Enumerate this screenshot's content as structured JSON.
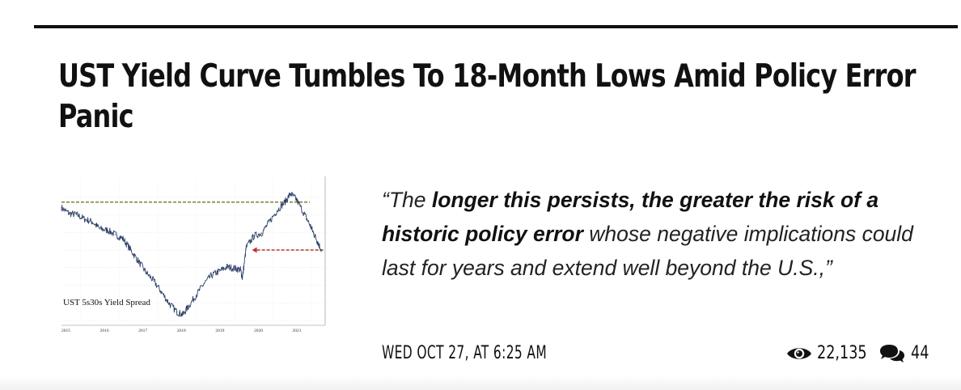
{
  "article": {
    "headline": "UST Yield Curve Tumbles To 18-Month Lows Amid Policy Error Panic",
    "excerpt": {
      "open_quote": "“The ",
      "bold_part": "longer this persists, the greater the risk of a historic policy error",
      "rest": " whose negative implications could last for years and extend well beyond the U.S.,”"
    },
    "date": "WED OCT 27, AT 6:25 AM",
    "views": "22,135",
    "comments": "44",
    "icons": {
      "views": "eye-icon",
      "comments": "comments-icon"
    }
  },
  "chart_data": {
    "type": "line",
    "title": "UST 5s30s Yield Spread",
    "x_tick_labels": [
      "2015",
      "2016",
      "2017",
      "2018",
      "2019",
      "2020",
      "2021"
    ],
    "xlim": [
      2015.0,
      2021.85
    ],
    "ylim": [
      0,
      100
    ],
    "series": [
      {
        "color": "#2b3e66",
        "x": [
          2015.0,
          2015.2,
          2015.4,
          2015.6,
          2015.8,
          2016.0,
          2016.2,
          2016.4,
          2016.6,
          2016.8,
          2017.0,
          2017.2,
          2017.4,
          2017.6,
          2017.8,
          2018.0,
          2018.15,
          2018.3,
          2018.5,
          2018.7,
          2018.9,
          2019.1,
          2019.3,
          2019.5,
          2019.65,
          2019.7,
          2019.8,
          2020.0,
          2020.2,
          2020.4,
          2020.6,
          2020.8,
          2020.95,
          2021.1,
          2021.3,
          2021.45,
          2021.55,
          2021.65,
          2021.75
        ],
        "y": [
          80,
          76,
          75,
          72,
          70,
          65,
          64,
          61,
          58,
          50,
          42,
          34,
          28,
          20,
          12,
          6,
          4,
          10,
          18,
          26,
          32,
          35,
          38,
          37,
          36,
          30,
          52,
          60,
          62,
          70,
          78,
          84,
          90,
          86,
          76,
          68,
          62,
          56,
          50
        ]
      }
    ],
    "annotations": [
      {
        "type": "horizontal-line",
        "style": "dashed",
        "color": "#6b7a1e",
        "y": 84,
        "x_from": 2015.0,
        "x_to": 2021.45
      },
      {
        "type": "arrow",
        "style": "dashed",
        "color": "#c03030",
        "y": 50,
        "x_from": 2021.8,
        "x_to": 2019.95
      }
    ]
  }
}
